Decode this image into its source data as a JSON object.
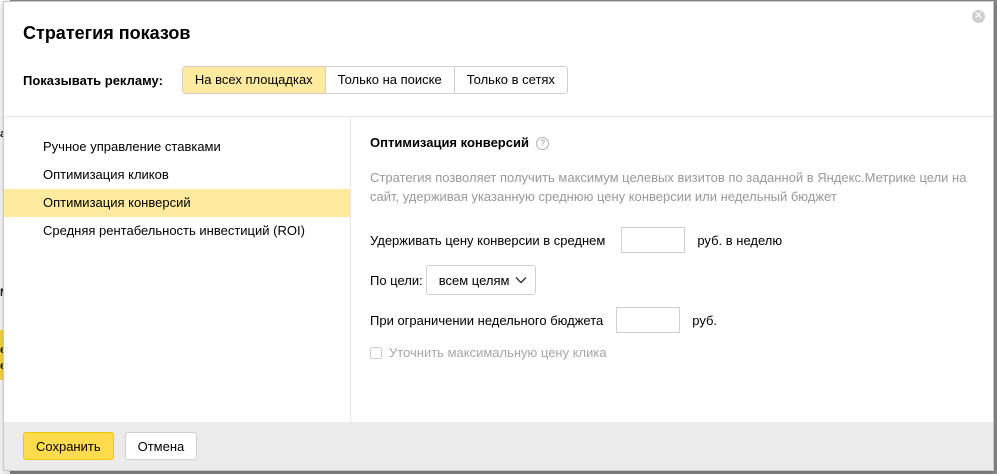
{
  "background_page": {
    "marks": [
      "a",
      "M",
      "e",
      "e"
    ]
  },
  "dialog": {
    "title": "Стратегия показов",
    "close_icon": "close-icon",
    "show_ads": {
      "label": "Показывать рекламу:",
      "options": [
        "На всех площадках",
        "Только на поиске",
        "Только в сетях"
      ],
      "selected": "На всех площадках"
    },
    "strategies": {
      "items": [
        "Ручное управление ставками",
        "Оптимизация кликов",
        "Оптимизация конверсий",
        "Средняя рентабельность инвестиций (ROI)"
      ],
      "selected": "Оптимизация конверсий"
    },
    "details": {
      "title": "Оптимизация конверсий",
      "help_icon": "?",
      "description": "Стратегия позволяет получить максимум целевых визитов по заданной в Яндекс.Метрике цели на сайт, удерживая указанную среднюю цену конверсии или недельный бюджет",
      "avg_price_label": "Удерживать цену конверсии в среднем",
      "avg_price_value": "",
      "avg_price_unit": "руб. в неделю",
      "goal_label": "По цели:",
      "goal_value": "всем целям",
      "budget_label": "При ограничении недельного бюджета",
      "budget_value": "",
      "budget_unit": "руб.",
      "max_click_price_label": "Уточнить максимальную цену клика",
      "max_click_price_checked": false
    },
    "footer": {
      "save_label": "Сохранить",
      "cancel_label": "Отмена"
    }
  },
  "colors": {
    "accent_yellow": "#ffdb4d",
    "selected_yellow": "#ffeba0",
    "footer_bg": "#ebebeb",
    "muted_text": "#999999"
  }
}
